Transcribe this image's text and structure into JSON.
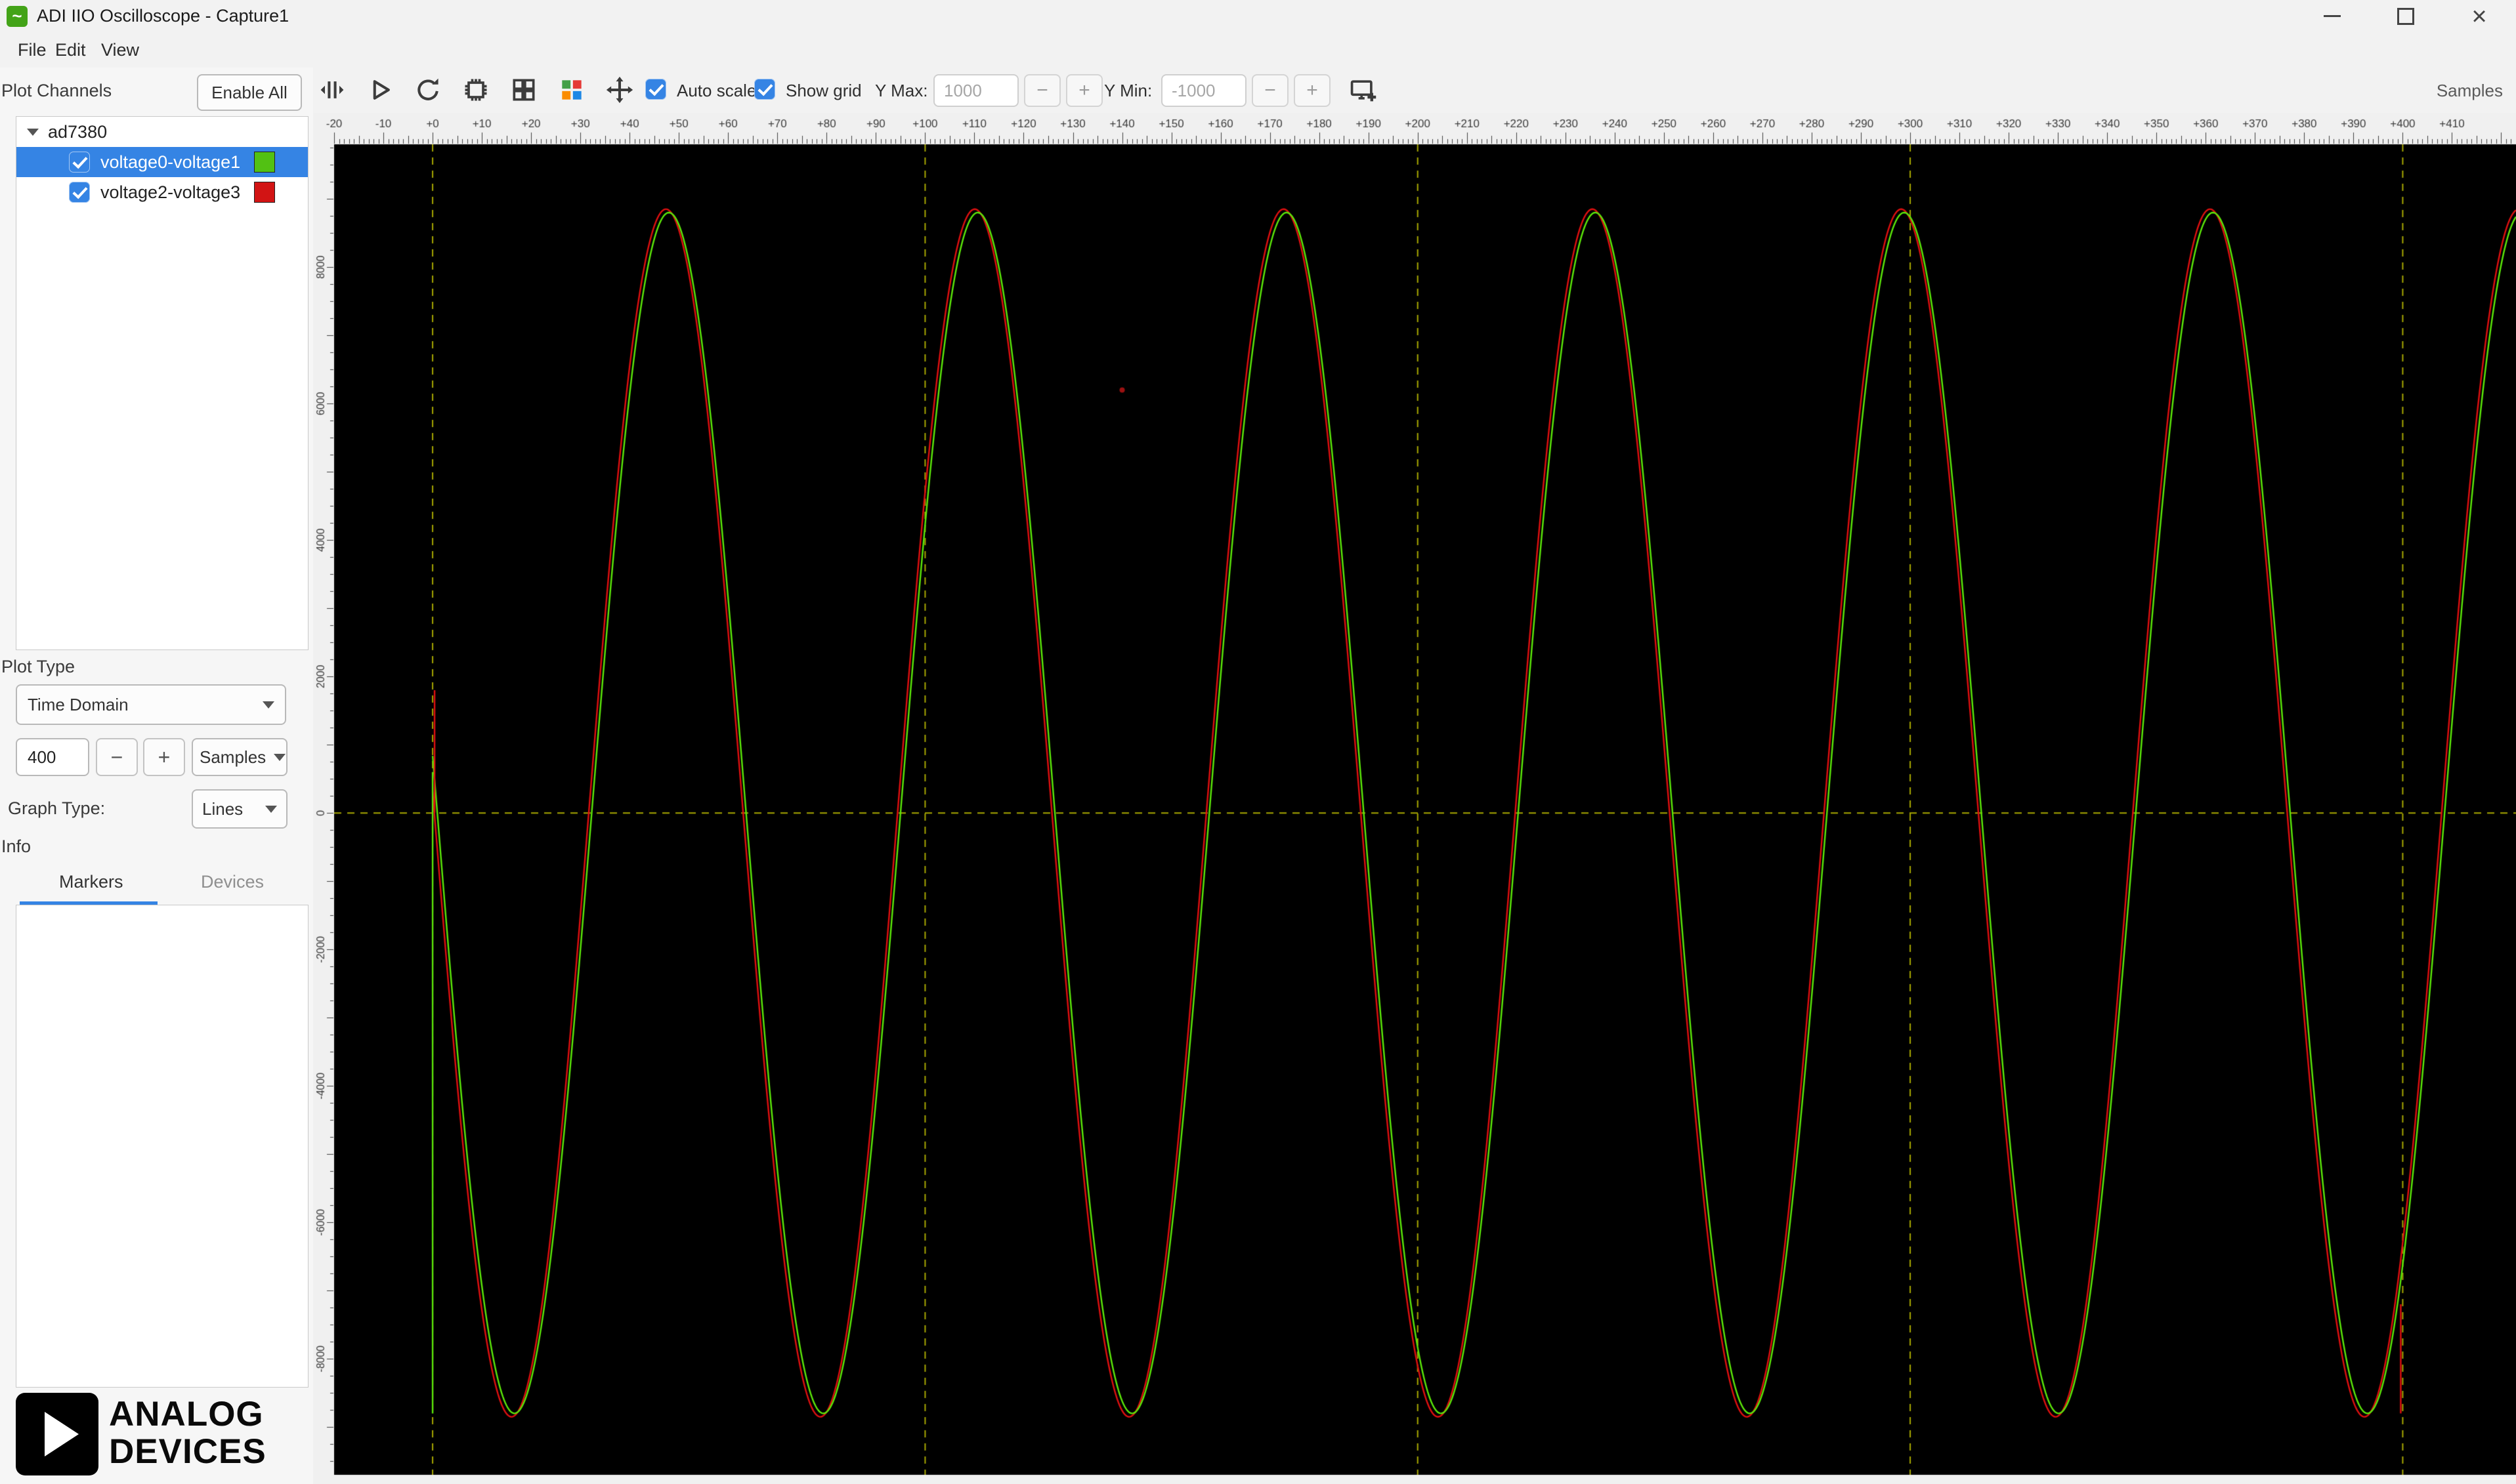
{
  "window": {
    "title": "ADI IIO Oscilloscope - Capture1",
    "controls": [
      "minimize",
      "maximize",
      "close"
    ]
  },
  "menu": {
    "items": [
      "File",
      "Edit",
      "View"
    ]
  },
  "sidebar": {
    "plot_channels_label": "Plot Channels",
    "enable_all_label": "Enable All",
    "device_tree": {
      "device": "ad7380",
      "channels": [
        {
          "label": "voltage0-voltage1",
          "checked": true,
          "color": "#52c113",
          "selected": true
        },
        {
          "label": "voltage2-voltage3",
          "checked": true,
          "color": "#d21414",
          "selected": false
        }
      ]
    },
    "plot_type_label": "Plot Type",
    "plot_type_value": "Time Domain",
    "sample_count": "400",
    "sample_unit_value": "Samples",
    "graph_type_label": "Graph Type:",
    "graph_type_value": "Lines",
    "info_label": "Info",
    "tabs": [
      {
        "label": "Markers",
        "active": true
      },
      {
        "label": "Devices",
        "active": false
      }
    ],
    "logo": {
      "line1": "ANALOG",
      "line2": "DEVICES"
    }
  },
  "toolbar": {
    "icons": [
      "capture-icon",
      "play-icon",
      "repeat-icon",
      "memory-icon",
      "grid-view-icon",
      "channels-grid-icon",
      "move-icon",
      "new-plot-icon"
    ],
    "auto_scale_label": "Auto scale",
    "auto_scale_checked": true,
    "show_grid_label": "Show grid",
    "show_grid_checked": true,
    "y_max_label": "Y Max:",
    "y_max_value": "1000",
    "y_min_label": "Y Min:",
    "y_min_value": "-1000",
    "stepper_minus": "−",
    "stepper_plus": "+",
    "samples_corner_label": "Samples",
    "accent_color": "#3584e4"
  },
  "chart_data": {
    "type": "line",
    "title": "",
    "xlabel": "Samples",
    "ylabel": "",
    "background": "#000000",
    "x_axis": {
      "visible_min": -20,
      "visible_max": 423,
      "label_start": -20,
      "label_end": 410,
      "label_step": 10,
      "minor_step": 1
    },
    "y_axis": {
      "ylim": [
        -9700,
        9800
      ],
      "tick_labels": [
        8000,
        6000,
        4000,
        2000,
        0,
        -2000,
        -4000,
        -6000,
        -8000
      ],
      "minor_step": 250,
      "major_step": 1000
    },
    "grid": {
      "on": true,
      "color": "#a9a900",
      "style": "dashed",
      "dash": [
        11,
        9
      ],
      "vlines": [
        0,
        100,
        200,
        300,
        400
      ],
      "hlines": [
        0
      ]
    },
    "ruler": {
      "bg": "#f0f0f0",
      "fg": "#3c3c3c"
    },
    "series": [
      {
        "name": "voltage2-voltage3",
        "color": "#e01010",
        "waveform": "sine",
        "amplitude": 8850,
        "period_samples": 62.7,
        "zero_cross_sample": 31.7,
        "sample_range": [
          0,
          423
        ]
      },
      {
        "name": "voltage0-voltage1",
        "color": "#5ce80a",
        "waveform": "sine",
        "amplitude": 8800,
        "period_samples": 62.7,
        "zero_cross_sample": 32.3,
        "sample_range": [
          0,
          423
        ]
      }
    ],
    "artifacts": [
      {
        "type": "vline",
        "color": "#5ce80a",
        "x": 0,
        "v1": -8800,
        "v2": 600
      },
      {
        "type": "vline",
        "color": "#e01010",
        "x": 0.4,
        "v1": 0,
        "v2": 1800
      },
      {
        "type": "vline",
        "color": "#e01010",
        "x": 399.6,
        "v1": -8800,
        "v2": -7200
      },
      {
        "type": "dot",
        "color": "#9b1111",
        "x": 140,
        "v": 6200,
        "r": 4
      }
    ]
  }
}
